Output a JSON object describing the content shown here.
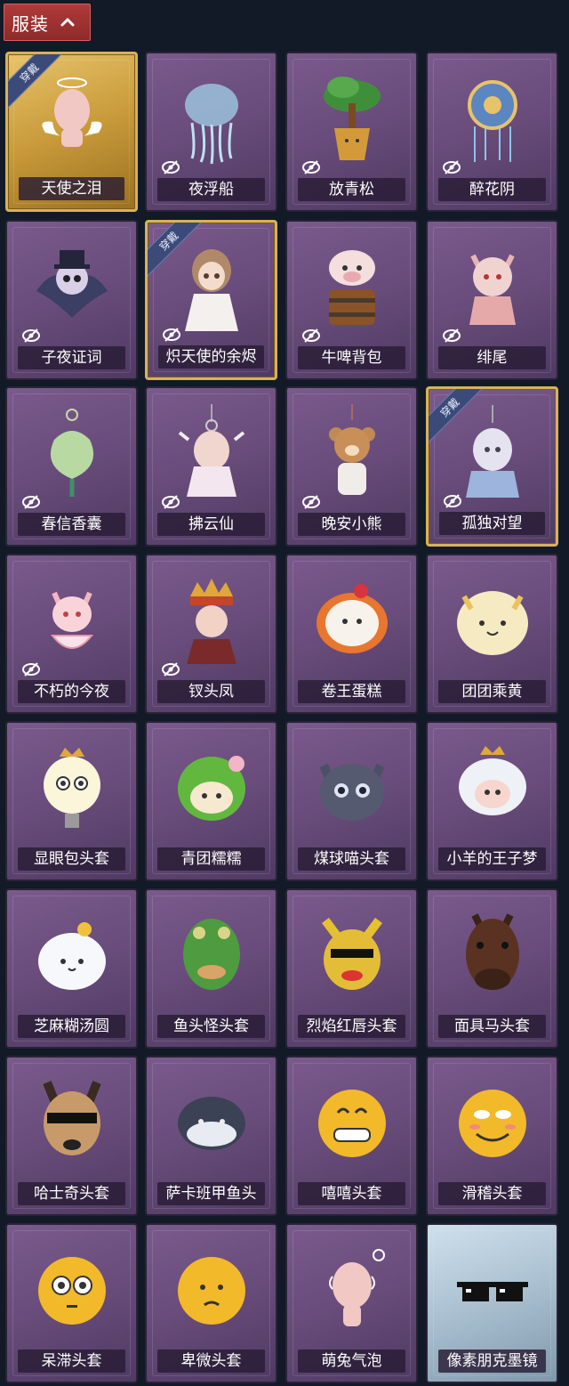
{
  "header": {
    "title": "服装",
    "icon": "chevron-up-icon",
    "color": "#9e3232"
  },
  "colors": {
    "background": "#111a26",
    "card": "#6a4d7c",
    "equipped_border": "#d7b258",
    "badge": "#3b4a78"
  },
  "items": [
    {
      "label": "天使之泪",
      "equipped": true,
      "badge": "穿戴",
      "hidden_icon": false,
      "style": "gold",
      "art": "angel"
    },
    {
      "label": "夜浮船",
      "equipped": false,
      "badge": "",
      "hidden_icon": true,
      "style": "normal",
      "art": "jellyfish"
    },
    {
      "label": "放青松",
      "equipped": false,
      "badge": "",
      "hidden_icon": true,
      "style": "normal",
      "art": "tree"
    },
    {
      "label": "醉花阴",
      "equipped": false,
      "badge": "",
      "hidden_icon": true,
      "style": "normal",
      "art": "ornament"
    },
    {
      "label": "子夜证词",
      "equipped": false,
      "badge": "",
      "hidden_icon": true,
      "style": "normal",
      "art": "crow"
    },
    {
      "label": "炽天使的余烬",
      "equipped": true,
      "badge": "穿戴",
      "hidden_icon": true,
      "style": "normal",
      "art": "doll"
    },
    {
      "label": "牛啤背包",
      "equipped": false,
      "badge": "",
      "hidden_icon": true,
      "style": "normal",
      "art": "cow"
    },
    {
      "label": "绯尾",
      "equipped": false,
      "badge": "",
      "hidden_icon": true,
      "style": "normal",
      "art": "fox"
    },
    {
      "label": "春信香囊",
      "equipped": false,
      "badge": "",
      "hidden_icon": true,
      "style": "normal",
      "art": "pouch"
    },
    {
      "label": "拂云仙",
      "equipped": false,
      "badge": "",
      "hidden_icon": true,
      "style": "normal",
      "art": "charm"
    },
    {
      "label": "晚安小熊",
      "equipped": false,
      "badge": "",
      "hidden_icon": true,
      "style": "normal",
      "art": "bear"
    },
    {
      "label": "孤独对望",
      "equipped": true,
      "badge": "穿戴",
      "hidden_icon": true,
      "style": "normal",
      "art": "charm2"
    },
    {
      "label": "不朽的今夜",
      "equipped": false,
      "badge": "",
      "hidden_icon": true,
      "style": "normal",
      "art": "pinkfox"
    },
    {
      "label": "钗头凤",
      "equipped": false,
      "badge": "",
      "hidden_icon": true,
      "style": "normal",
      "art": "crown"
    },
    {
      "label": "卷王蛋糕",
      "equipped": false,
      "badge": "",
      "hidden_icon": false,
      "style": "normal",
      "art": "cake"
    },
    {
      "label": "团团乘黄",
      "equipped": false,
      "badge": "",
      "hidden_icon": false,
      "style": "normal",
      "art": "yellowhead"
    },
    {
      "label": "显眼包头套",
      "equipped": false,
      "badge": "",
      "hidden_icon": false,
      "style": "normal",
      "art": "bulb"
    },
    {
      "label": "青团糯糯",
      "equipped": false,
      "badge": "",
      "hidden_icon": false,
      "style": "normal",
      "art": "greenhead"
    },
    {
      "label": "煤球喵头套",
      "equipped": false,
      "badge": "",
      "hidden_icon": false,
      "style": "normal",
      "art": "cat"
    },
    {
      "label": "小羊的王子梦",
      "equipped": false,
      "badge": "",
      "hidden_icon": false,
      "style": "normal",
      "art": "sheep"
    },
    {
      "label": "芝麻糊汤圆",
      "equipped": false,
      "badge": "",
      "hidden_icon": false,
      "style": "normal",
      "art": "dumpling"
    },
    {
      "label": "鱼头怪头套",
      "equipped": false,
      "badge": "",
      "hidden_icon": false,
      "style": "normal",
      "art": "fish"
    },
    {
      "label": "烈焰红唇头套",
      "equipped": false,
      "badge": "",
      "hidden_icon": false,
      "style": "normal",
      "art": "pikachu"
    },
    {
      "label": "面具马头套",
      "equipped": false,
      "badge": "",
      "hidden_icon": false,
      "style": "normal",
      "art": "horse"
    },
    {
      "label": "哈士奇头套",
      "equipped": false,
      "badge": "",
      "hidden_icon": false,
      "style": "normal",
      "art": "dog"
    },
    {
      "label": "萨卡班甲鱼头",
      "equipped": false,
      "badge": "",
      "hidden_icon": false,
      "style": "normal",
      "art": "blackfish"
    },
    {
      "label": "嘻嘻头套",
      "equipped": false,
      "badge": "",
      "hidden_icon": false,
      "style": "normal",
      "art": "grin"
    },
    {
      "label": "滑稽头套",
      "equipped": false,
      "badge": "",
      "hidden_icon": false,
      "style": "normal",
      "art": "funny"
    },
    {
      "label": "呆滞头套",
      "equipped": false,
      "badge": "",
      "hidden_icon": false,
      "style": "normal",
      "art": "stare"
    },
    {
      "label": "卑微头套",
      "equipped": false,
      "badge": "",
      "hidden_icon": false,
      "style": "normal",
      "art": "humble"
    },
    {
      "label": "萌兔气泡",
      "equipped": false,
      "badge": "",
      "hidden_icon": false,
      "style": "normal",
      "art": "bubble"
    },
    {
      "label": "像素朋克墨镜",
      "equipped": false,
      "badge": "",
      "hidden_icon": false,
      "style": "clear",
      "art": "glasses"
    }
  ]
}
